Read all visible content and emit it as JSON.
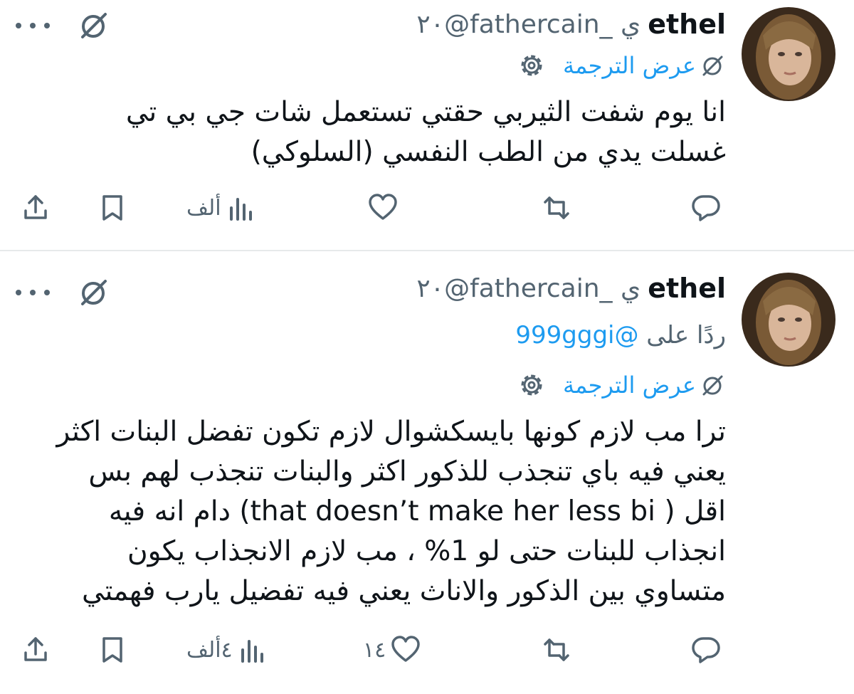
{
  "colors": {
    "accent": "#1d9bf0",
    "text": "#0f1419",
    "muted": "#536471",
    "divider": "#e7e9ea"
  },
  "icons": [
    "more-icon",
    "grok-icon",
    "translate-icon",
    "gear-icon",
    "reply-icon",
    "retweet-icon",
    "like-icon",
    "views-icon",
    "bookmark-icon",
    "share-icon"
  ],
  "tweets": [
    {
      "display_name": "ethel",
      "handle_time": "٢٠@fathercain_ ي",
      "translate_label": "عرض الترجمة",
      "body_lines": [
        "انا يوم شفت الثيربي حقتي تستعمل شات جي بي تي",
        "غسلت يدي من الطب النفسي (السلوكي)"
      ],
      "like_count": "",
      "views_count": "ألف"
    },
    {
      "display_name": "ethel",
      "handle_time": "٢٠@fathercain_ ي",
      "reply_prefix": "ردًا على",
      "reply_mention": "@999gggi",
      "translate_label": "عرض الترجمة",
      "body_lines": [
        "ترا مب لازم كونها بايسكشوال لازم تكون تفضل البنات اكثر",
        "يعني فيه باي تنجذب للذكور اكثر والبنات تنجذب لهم بس",
        "اقل ( that doesn’t make her less bi) دام انه فيه",
        "انجذاب للبنات حتى لو 1% ، مب لازم الانجذاب يكون",
        "متساوي بين الذكور والاناث يعني فيه تفضيل يارب فهمتي"
      ],
      "like_count": "١٤",
      "views_count": "٤ألف"
    }
  ]
}
